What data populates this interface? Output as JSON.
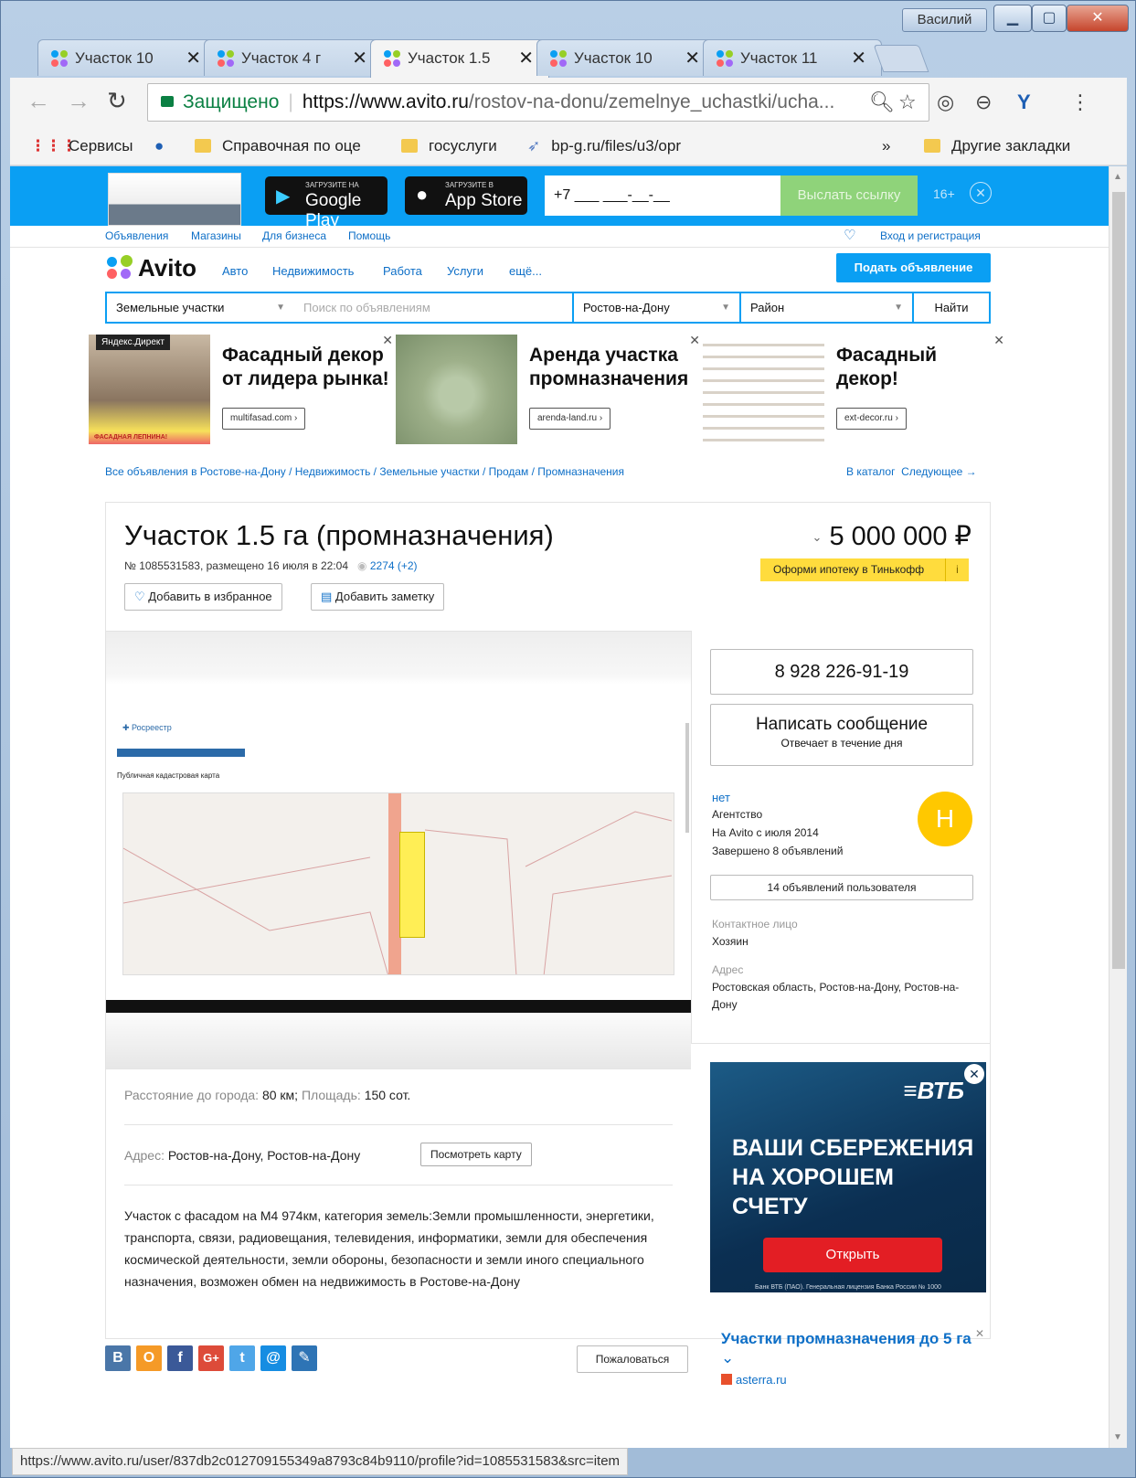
{
  "window": {
    "user": "Василий"
  },
  "tabs": [
    {
      "label": "Участок 10"
    },
    {
      "label": "Участок 4 г"
    },
    {
      "label": "Участок 1.5"
    },
    {
      "label": "Участок 10"
    },
    {
      "label": "Участок 11"
    }
  ],
  "omnibox": {
    "secure_label": "Защищено",
    "url_host": "https://www.avito.ru",
    "url_path": "/rostov-na-donu/zemelnye_uchastki/ucha..."
  },
  "bookmarks": [
    {
      "label": "Сервисы"
    },
    {
      "label": "Справочная по оце"
    },
    {
      "label": "госуслуги"
    },
    {
      "label": "bp-g.ru/files/u3/opr"
    },
    {
      "label": "»"
    },
    {
      "label": "Другие закладки"
    }
  ],
  "app_banner": {
    "gp_small": "ЗАГРУЗИТЕ НА",
    "gp_big": "Google Play",
    "as_small": "Загрузите в",
    "as_big": "App Store",
    "phone_placeholder": "+7 ___ ___-__-__",
    "send_label": "Выслать ссылку",
    "age": "16+"
  },
  "top_nav": {
    "items": [
      "Объявления",
      "Магазины",
      "Для бизнеса",
      "Помощь"
    ],
    "login": "Вход и регистрация"
  },
  "logo": "Avito",
  "categories": [
    "Авто",
    "Недвижимость",
    "Работа",
    "Услуги",
    "ещё..."
  ],
  "post_ad": "Подать объявление",
  "search": {
    "category": "Земельные участки",
    "placeholder": "Поиск по объявлениям",
    "city": "Ростов-на-Дону",
    "district": "Район",
    "button": "Найти"
  },
  "ads": [
    {
      "title": "Фасадный декор от лидера рынка!",
      "title_l1": "Фасадный декор",
      "title_l2": "от лидера рынка!",
      "link": "multifasad.com ›",
      "badge": "Яндекс.Директ",
      "img_caption": "ФАСАДНАЯ ЛЕПНИНА!"
    },
    {
      "title_l1": "Аренда участка",
      "title_l2": "промназначения",
      "link": "arenda-land.ru ›"
    },
    {
      "title_l1": "Фасадный",
      "title_l2": "декор!",
      "link": "ext-decor.ru ›"
    }
  ],
  "breadcrumb": {
    "path": "Все объявления в Ростове-на-Дону / Недвижимость / Земельные участки / Продам / Промназначения",
    "catalog": "В каталог",
    "next": "Следующее →"
  },
  "item": {
    "title": "Участок 1.5 га (промназначения)",
    "meta": "№ 1085531583, размещено 16 июля в 22:04",
    "views": "2274 (+2)",
    "price": "5 000 000 ₽",
    "mortgage": "Оформи ипотеку в Тинькофф",
    "favorite": "Добавить в избранное",
    "note": "Добавить заметку",
    "distance_label": "Расстояние до города:",
    "distance_value": "80 км;",
    "area_label": "Площадь:",
    "area_value": "150 сот.",
    "address_label": "Адрес:",
    "address_value": "Ростов-на-Дону, Ростов-на-Дону",
    "map_button": "Посмотреть карту",
    "description": "Участок с фасадом на М4 974км, категория земель:Земли промышленности, энергетики, транспорта, связи, радиовещания, телевидения, информатики, земли для обеспечения космической деятельности, земли обороны, безопасности и земли иного специального назначения, возможен обмен на недвижимость в Ростове-на-Дону",
    "report": "Пожаловаться"
  },
  "gallery": {
    "site_label": "Росреестр",
    "map_title": "Публичная кадастровая карта"
  },
  "seller": {
    "phone": "8 928 226-91-19",
    "message": "Написать сообщение",
    "reply": "Отвечает в течение дня",
    "name": "нет",
    "type": "Агентство",
    "since": "На Avito с июля 2014",
    "done": "Завершено 8 объявлений",
    "avatar": "Н",
    "user_ads": "14 объявлений пользователя",
    "contact_label": "Контактное лицо",
    "contact_value": "Хозяин",
    "address_label": "Адрес",
    "address_value": "Ростовская область, Ростов-на-Дону, Ростов-на-Дону"
  },
  "vtb": {
    "logo": "ВТБ",
    "headline_1": "ВАШИ СБЕРЕЖЕНИЯ",
    "headline_2": "НА ХОРОШЕМ",
    "headline_3": "СЧЕТУ",
    "button": "Открыть",
    "legal": "Банк ВТБ (ПАО). Генеральная лицензия Банка России № 1000"
  },
  "side_ad": {
    "title": "Участки промназначения до 5 га",
    "link": "asterra.ru"
  },
  "share": [
    "В",
    "О",
    "f",
    "G+",
    "t",
    "@",
    "✎"
  ],
  "status_url": "https://www.avito.ru/user/837db2c012709155349a8793c84b9110/profile?id=1085531583&src=item",
  "colors": {
    "accent": "#0a9ff3",
    "link": "#0e6fc7",
    "avatar": "#ffc800",
    "mortgage": "#ffdc3d"
  }
}
